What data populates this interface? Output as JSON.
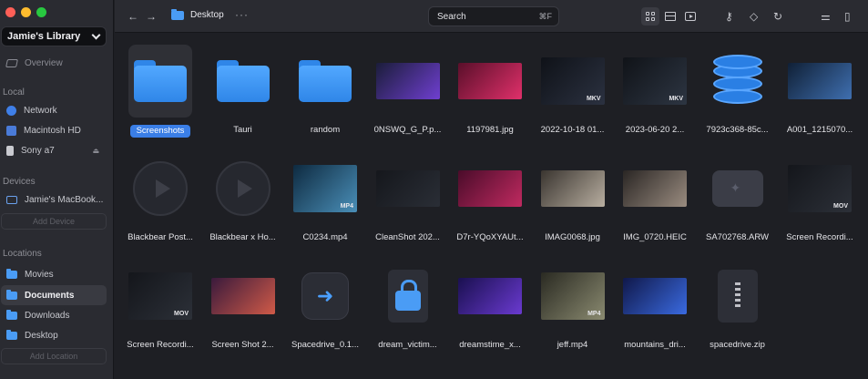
{
  "sidebar": {
    "library": "Jamie's Library",
    "overview": "Overview",
    "sections": {
      "local": "Local",
      "devices": "Devices",
      "locations": "Locations"
    },
    "local_items": [
      {
        "label": "Network",
        "icon": "globe-icon"
      },
      {
        "label": "Macintosh HD",
        "icon": "hard-drive-icon"
      },
      {
        "label": "Sony a7",
        "icon": "camera-icon"
      }
    ],
    "device_items": [
      {
        "label": "Jamie's MacBook...",
        "icon": "laptop-icon"
      }
    ],
    "add_device": "Add Device",
    "location_items": [
      {
        "label": "Movies",
        "active": false
      },
      {
        "label": "Documents",
        "active": true
      },
      {
        "label": "Downloads",
        "active": false
      },
      {
        "label": "Desktop",
        "active": false
      }
    ],
    "add_location": "Add Location"
  },
  "toolbar": {
    "path": "Desktop",
    "search_placeholder": "Search",
    "search_shortcut": "⌘F"
  },
  "files": [
    {
      "name": "Screenshots",
      "kind": "folder",
      "selected": true
    },
    {
      "name": "Tauri",
      "kind": "folder"
    },
    {
      "name": "random",
      "kind": "folder"
    },
    {
      "name": "0NSWQ_G_P.p...",
      "kind": "image",
      "colors": [
        "#1b1d3a",
        "#6f3fd0"
      ]
    },
    {
      "name": "1197981.jpg",
      "kind": "image",
      "colors": [
        "#5a0f2a",
        "#e0306a"
      ]
    },
    {
      "name": "2022-10-18 01...",
      "kind": "video",
      "badge": "MKV",
      "colors": [
        "#0f1218",
        "#2b3140"
      ]
    },
    {
      "name": "2023-06-20 2...",
      "kind": "video",
      "badge": "MKV",
      "colors": [
        "#101318",
        "#2d3542"
      ]
    },
    {
      "name": "7923c368-85c...",
      "kind": "database"
    },
    {
      "name": "A001_1215070...",
      "kind": "image",
      "colors": [
        "#102036",
        "#3f6fb0"
      ]
    },
    {
      "name": "Blackbear Post...",
      "kind": "poster"
    },
    {
      "name": "Blackbear x Ho...",
      "kind": "poster"
    },
    {
      "name": "C0234.mp4",
      "kind": "video",
      "badge": "MP4",
      "colors": [
        "#0e2a40",
        "#4a8fb8"
      ]
    },
    {
      "name": "CleanShot 202...",
      "kind": "image",
      "colors": [
        "#15171c",
        "#2a2e36"
      ]
    },
    {
      "name": "D7r-YQoXYAUt...",
      "kind": "image",
      "colors": [
        "#4a0c2a",
        "#c02a60"
      ]
    },
    {
      "name": "IMAG0068.jpg",
      "kind": "image",
      "colors": [
        "#3a3530",
        "#b8aea0"
      ]
    },
    {
      "name": "IMG_0720.HEIC",
      "kind": "image",
      "colors": [
        "#2a2624",
        "#9a8c80"
      ]
    },
    {
      "name": "SA702768.ARW",
      "kind": "raw"
    },
    {
      "name": "Screen Recordi...",
      "kind": "video",
      "badge": "MOV",
      "colors": [
        "#14161b",
        "#2c3038"
      ]
    },
    {
      "name": "Screen Recordi...",
      "kind": "video",
      "badge": "MOV",
      "colors": [
        "#14161b",
        "#2c3038"
      ]
    },
    {
      "name": "Screen Shot 2...",
      "kind": "image",
      "colors": [
        "#3a1a3c",
        "#d05a48"
      ]
    },
    {
      "name": "Spacedrive_0.1...",
      "kind": "app"
    },
    {
      "name": "dream_victim...",
      "kind": "locked"
    },
    {
      "name": "dreamstime_x...",
      "kind": "image",
      "colors": [
        "#1a1050",
        "#6a3ad0"
      ]
    },
    {
      "name": "jeff.mp4",
      "kind": "video",
      "badge": "MP4",
      "colors": [
        "#2a2a22",
        "#8a8a70"
      ]
    },
    {
      "name": "mountains_dri...",
      "kind": "image",
      "colors": [
        "#10184a",
        "#3a6ae0"
      ]
    },
    {
      "name": "spacedrive.zip",
      "kind": "zip"
    }
  ]
}
